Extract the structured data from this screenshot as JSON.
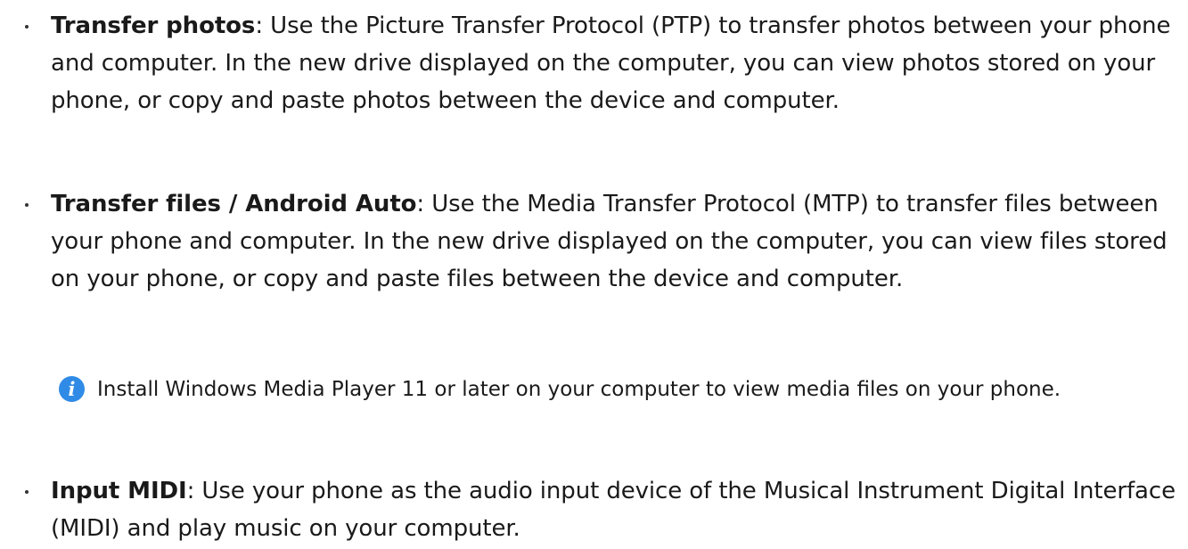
{
  "items": [
    {
      "title": "Transfer photos",
      "text": ": Use the Picture Transfer Protocol (PTP) to transfer photos between your phone and computer. In the new drive displayed on the computer, you can view photos stored on your phone, or copy and paste photos between the device and computer."
    },
    {
      "title": "Transfer files / Android Auto",
      "text": ": Use the Media Transfer Protocol (MTP) to transfer files between your phone and computer. In the new drive displayed on the computer, you can view files stored on your phone, or copy and paste files between the device and computer."
    },
    {
      "title": "Input MIDI",
      "text": ": Use your phone as the audio input device of the Musical Instrument Digital Interface (MIDI) and play music on your computer."
    }
  ],
  "note": {
    "icon": "info-icon",
    "icon_glyph": "i",
    "text": "Install Windows Media Player 11 or later on your computer to view media files on your phone."
  },
  "colors": {
    "text": "#1a1a1a",
    "note_icon": "#2f8be6"
  }
}
